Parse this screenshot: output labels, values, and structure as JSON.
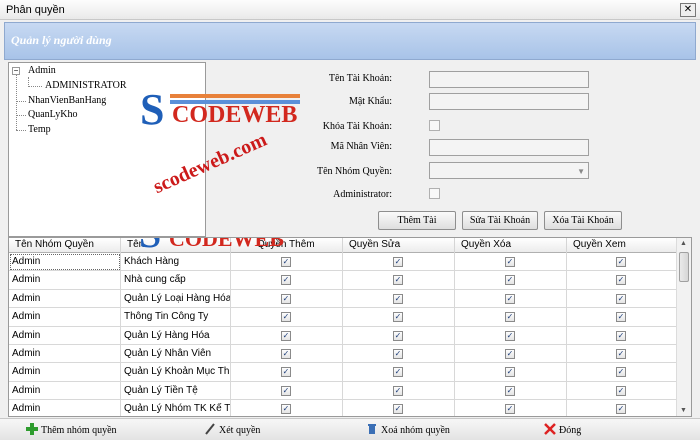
{
  "window": {
    "title": "Phân quyền",
    "close": "✕"
  },
  "banner": {
    "title": "Quản lý người dùng"
  },
  "tree": {
    "expander": "−",
    "root": "Admin",
    "child": "ADMINISTRATOR",
    "items": [
      "NhanVienBanHang",
      "QuanLyKho",
      "Temp"
    ]
  },
  "form": {
    "username_label": "Tên Tài Khoản:",
    "password_label": "Mật Khẩu:",
    "lock_label": "Khóa Tài Khoản:",
    "staff_id_label": "Mã Nhân Viên:",
    "group_label": "Tên Nhóm Quyền:",
    "admin_label": "Administrator:",
    "username_value": "",
    "password_value": "",
    "staff_id_value": "",
    "group_value": ""
  },
  "buttons": {
    "add": "Thêm Tài",
    "edit": "Sửa Tài Khoản",
    "delete": "Xóa Tài Khoản"
  },
  "grid": {
    "headers": [
      "Tên Nhóm Quyền",
      "Tên",
      "Quyền Thêm",
      "Quyền Sửa",
      "Quyền Xóa",
      "Quyền Xem"
    ],
    "rows": [
      {
        "group": "Admin",
        "name": "Khách Hàng"
      },
      {
        "group": "Admin",
        "name": "Nhà cung cấp"
      },
      {
        "group": "Admin",
        "name": "Quản Lý Loại Hàng Hóa"
      },
      {
        "group": "Admin",
        "name": "Thông Tin Công Ty"
      },
      {
        "group": "Admin",
        "name": "Quản Lý Hàng Hóa"
      },
      {
        "group": "Admin",
        "name": "Quản Lý Nhân Viên"
      },
      {
        "group": "Admin",
        "name": "Quản Lý Khoản Mục Th..."
      },
      {
        "group": "Admin",
        "name": "Quản Lý Tiền Tệ"
      },
      {
        "group": "Admin",
        "name": "Quản Lý Nhóm TK Kế T..."
      }
    ],
    "check_glyph": "✓"
  },
  "toolbar": {
    "add_group": "Thêm nhóm quyền",
    "set_perm": "Xét quyền",
    "delete_group": "Xoá nhóm quyền",
    "close": "Đóng"
  },
  "watermarks": {
    "logo_s": "S",
    "logo_rest": "CODEWEB",
    "url": "scodeweb.com"
  },
  "colors": {
    "banner": "#b3cbeb",
    "logo_blue": "#1f5fb8",
    "logo_red": "#d2281e"
  },
  "icons": {
    "add": "plus-icon",
    "set": "pencil-icon",
    "delete": "trash-icon",
    "close": "x-icon"
  }
}
